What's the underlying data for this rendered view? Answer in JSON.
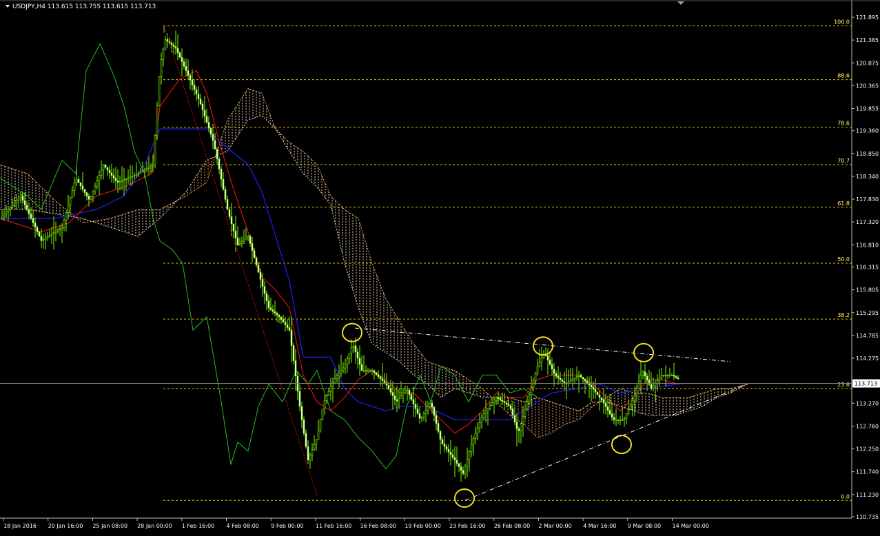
{
  "chart_data": {
    "type": "candlestick",
    "symbol_header": "USDJPY,H4  113.615 113.755 113.615 113.713",
    "y_ticks": [
      "121.895",
      "121.385",
      "120.875",
      "120.365",
      "119.855",
      "119.360",
      "118.850",
      "118.340",
      "117.830",
      "117.320",
      "116.810",
      "116.315",
      "115.805",
      "115.295",
      "114.785",
      "114.275",
      "113.713",
      "113.270",
      "112.760",
      "112.250",
      "111.740",
      "111.230",
      "110.735"
    ],
    "ylim": [
      110.735,
      121.895
    ],
    "x_ticks": [
      "18 Jan 2016",
      "20 Jan 16:00",
      "25 Jan 08:00",
      "28 Jan 00:00",
      "1 Feb 16:00",
      "4 Feb 08:00",
      "9 Feb 00:00",
      "11 Feb 16:00",
      "16 Feb 08:00",
      "19 Feb 00:00",
      "23 Feb 16:00",
      "26 Feb 08:00",
      "2 Mar 00:00",
      "4 Mar 16:00",
      "9 Mar 08:00",
      "14 Mar 00:00"
    ],
    "current_price": "113.713",
    "fibonacci": {
      "high": 121.7,
      "low": 111.1,
      "levels": [
        {
          "label": "100.0",
          "value": 121.7
        },
        {
          "label": "88.6",
          "value": 120.5
        },
        {
          "label": "78.6",
          "value": 119.44
        },
        {
          "label": "70.7",
          "value": 118.6
        },
        {
          "label": "61.8",
          "value": 117.65
        },
        {
          "label": "50.0",
          "value": 116.4
        },
        {
          "label": "38.2",
          "value": 115.15
        },
        {
          "label": "23.6",
          "value": 113.6
        },
        {
          "label": "0.0",
          "value": 111.1
        }
      ]
    },
    "price_path": [
      [
        0,
        117.4
      ],
      [
        30,
        117.9
      ],
      [
        60,
        116.9
      ],
      [
        90,
        117.2
      ],
      [
        110,
        118.3
      ],
      [
        130,
        117.8
      ],
      [
        150,
        118.6
      ],
      [
        170,
        118.2
      ],
      [
        200,
        118.4
      ],
      [
        222,
        118.6
      ],
      [
        232,
        120.8
      ],
      [
        240,
        121.4
      ],
      [
        255,
        121.2
      ],
      [
        270,
        120.7
      ],
      [
        290,
        120.0
      ],
      [
        310,
        119.1
      ],
      [
        330,
        117.6
      ],
      [
        345,
        116.8
      ],
      [
        360,
        117.0
      ],
      [
        375,
        116.2
      ],
      [
        390,
        115.4
      ],
      [
        405,
        115.2
      ],
      [
        420,
        114.9
      ],
      [
        435,
        113.2
      ],
      [
        447,
        112.0
      ],
      [
        460,
        112.5
      ],
      [
        470,
        113.3
      ],
      [
        485,
        113.8
      ],
      [
        500,
        114.1
      ],
      [
        512,
        114.6
      ],
      [
        525,
        114.0
      ],
      [
        540,
        114.0
      ],
      [
        560,
        113.7
      ],
      [
        575,
        113.3
      ],
      [
        590,
        113.6
      ],
      [
        610,
        112.9
      ],
      [
        625,
        113.3
      ],
      [
        640,
        112.4
      ],
      [
        660,
        112.0
      ],
      [
        672,
        111.7
      ],
      [
        685,
        112.4
      ],
      [
        700,
        113.0
      ],
      [
        720,
        113.4
      ],
      [
        740,
        113.2
      ],
      [
        752,
        112.6
      ],
      [
        765,
        113.3
      ],
      [
        780,
        114.1
      ],
      [
        790,
        114.4
      ],
      [
        805,
        113.9
      ],
      [
        820,
        113.7
      ],
      [
        840,
        113.9
      ],
      [
        860,
        113.6
      ],
      [
        875,
        113.3
      ],
      [
        890,
        112.9
      ],
      [
        905,
        112.9
      ],
      [
        920,
        113.4
      ],
      [
        932,
        114.0
      ],
      [
        945,
        113.6
      ],
      [
        960,
        113.9
      ],
      [
        975,
        113.9
      ],
      [
        985,
        113.8
      ]
    ],
    "tenkan": [
      [
        0,
        117.4
      ],
      [
        60,
        117.1
      ],
      [
        100,
        117.3
      ],
      [
        140,
        117.9
      ],
      [
        180,
        118.1
      ],
      [
        220,
        118.4
      ],
      [
        232,
        119.9
      ],
      [
        260,
        120.5
      ],
      [
        285,
        120.7
      ],
      [
        300,
        120.2
      ],
      [
        320,
        119.0
      ],
      [
        340,
        118.0
      ],
      [
        360,
        117.1
      ],
      [
        380,
        116.1
      ],
      [
        400,
        115.8
      ],
      [
        420,
        115.4
      ],
      [
        440,
        113.9
      ],
      [
        460,
        113.3
      ],
      [
        480,
        113.1
      ],
      [
        500,
        113.4
      ],
      [
        520,
        113.8
      ],
      [
        540,
        114.0
      ],
      [
        560,
        113.8
      ],
      [
        580,
        113.5
      ],
      [
        600,
        113.5
      ],
      [
        620,
        113.2
      ],
      [
        640,
        112.9
      ],
      [
        660,
        112.6
      ],
      [
        680,
        112.8
      ],
      [
        700,
        113.1
      ],
      [
        720,
        113.5
      ],
      [
        740,
        113.4
      ],
      [
        760,
        113.4
      ],
      [
        780,
        113.8
      ],
      [
        800,
        113.9
      ],
      [
        820,
        113.9
      ],
      [
        840,
        113.9
      ],
      [
        860,
        113.7
      ],
      [
        880,
        113.4
      ],
      [
        900,
        113.1
      ],
      [
        920,
        113.4
      ],
      [
        940,
        113.8
      ],
      [
        960,
        113.8
      ],
      [
        985,
        113.7
      ]
    ],
    "kijun": [
      [
        0,
        117.4
      ],
      [
        80,
        117.4
      ],
      [
        140,
        117.6
      ],
      [
        180,
        117.9
      ],
      [
        210,
        118.6
      ],
      [
        232,
        119.4
      ],
      [
        260,
        119.4
      ],
      [
        300,
        119.4
      ],
      [
        320,
        119.1
      ],
      [
        360,
        118.6
      ],
      [
        380,
        118.0
      ],
      [
        400,
        117.0
      ],
      [
        420,
        116.0
      ],
      [
        440,
        114.3
      ],
      [
        480,
        114.3
      ],
      [
        500,
        113.6
      ],
      [
        520,
        113.3
      ],
      [
        560,
        113.1
      ],
      [
        580,
        113.2
      ],
      [
        620,
        113.2
      ],
      [
        660,
        112.9
      ],
      [
        700,
        112.9
      ],
      [
        740,
        112.9
      ],
      [
        770,
        113.2
      ],
      [
        800,
        113.5
      ],
      [
        840,
        113.6
      ],
      [
        870,
        113.7
      ],
      [
        900,
        113.5
      ],
      [
        940,
        113.6
      ],
      [
        985,
        113.7
      ]
    ],
    "chikou": [
      [
        0,
        118.3
      ],
      [
        40,
        117.9
      ],
      [
        60,
        117.6
      ],
      [
        90,
        118.7
      ],
      [
        110,
        118.4
      ],
      [
        125,
        120.7
      ],
      [
        145,
        121.3
      ],
      [
        165,
        120.6
      ],
      [
        180,
        119.9
      ],
      [
        195,
        118.9
      ],
      [
        210,
        118.4
      ],
      [
        222,
        117.4
      ],
      [
        232,
        116.9
      ],
      [
        250,
        116.7
      ],
      [
        265,
        116.4
      ],
      [
        280,
        114.9
      ],
      [
        300,
        115.2
      ],
      [
        320,
        113.4
      ],
      [
        335,
        111.9
      ],
      [
        345,
        112.4
      ],
      [
        360,
        112.2
      ],
      [
        375,
        113.2
      ],
      [
        390,
        113.7
      ],
      [
        410,
        113.3
      ],
      [
        430,
        114.0
      ],
      [
        447,
        113.7
      ],
      [
        460,
        114.0
      ],
      [
        480,
        113.1
      ],
      [
        500,
        112.9
      ],
      [
        520,
        112.5
      ],
      [
        540,
        112.2
      ],
      [
        560,
        111.8
      ],
      [
        575,
        112.1
      ],
      [
        590,
        113.2
      ],
      [
        610,
        113.9
      ],
      [
        625,
        113.3
      ],
      [
        640,
        114.1
      ],
      [
        660,
        113.9
      ],
      [
        680,
        113.3
      ],
      [
        700,
        113.9
      ],
      [
        720,
        113.9
      ],
      [
        740,
        113.5
      ],
      [
        760,
        113.6
      ],
      [
        780,
        113.4
      ]
    ],
    "cloud": {
      "span_a": [
        [
          0,
          118.6
        ],
        [
          40,
          118.4
        ],
        [
          80,
          117.8
        ],
        [
          120,
          117.3
        ],
        [
          160,
          117.4
        ],
        [
          200,
          117.6
        ],
        [
          232,
          117.6
        ],
        [
          270,
          117.9
        ],
        [
          300,
          118.2
        ],
        [
          330,
          119.6
        ],
        [
          360,
          120.3
        ],
        [
          380,
          120.2
        ],
        [
          400,
          119.4
        ],
        [
          420,
          119.1
        ],
        [
          440,
          118.9
        ],
        [
          460,
          118.6
        ],
        [
          480,
          117.9
        ],
        [
          500,
          117.6
        ],
        [
          520,
          117.4
        ],
        [
          540,
          116.4
        ],
        [
          560,
          115.6
        ],
        [
          580,
          115.1
        ],
        [
          600,
          114.6
        ],
        [
          620,
          114.2
        ],
        [
          640,
          114.1
        ],
        [
          660,
          114.0
        ],
        [
          680,
          113.8
        ],
        [
          700,
          113.6
        ],
        [
          720,
          113.3
        ],
        [
          740,
          113.0
        ],
        [
          760,
          112.8
        ],
        [
          780,
          112.5
        ],
        [
          800,
          112.6
        ],
        [
          820,
          112.8
        ],
        [
          840,
          112.9
        ],
        [
          860,
          113.2
        ],
        [
          880,
          113.4
        ],
        [
          900,
          113.6
        ],
        [
          920,
          113.5
        ],
        [
          940,
          113.5
        ],
        [
          960,
          113.4
        ],
        [
          980,
          113.4
        ],
        [
          1000,
          113.4
        ],
        [
          1020,
          113.5
        ],
        [
          1040,
          113.6
        ],
        [
          1060,
          113.6
        ],
        [
          1085,
          113.7
        ]
      ],
      "span_b": [
        [
          0,
          117.6
        ],
        [
          40,
          117.6
        ],
        [
          80,
          117.5
        ],
        [
          120,
          117.4
        ],
        [
          160,
          117.2
        ],
        [
          200,
          117.0
        ],
        [
          232,
          117.4
        ],
        [
          270,
          118.0
        ],
        [
          300,
          118.7
        ],
        [
          330,
          118.9
        ],
        [
          360,
          119.6
        ],
        [
          380,
          119.7
        ],
        [
          400,
          119.4
        ],
        [
          420,
          118.9
        ],
        [
          440,
          118.4
        ],
        [
          460,
          118.1
        ],
        [
          480,
          117.7
        ],
        [
          500,
          116.4
        ],
        [
          520,
          115.4
        ],
        [
          540,
          114.6
        ],
        [
          560,
          114.4
        ],
        [
          580,
          114.2
        ],
        [
          600,
          113.9
        ],
        [
          620,
          113.7
        ],
        [
          640,
          113.4
        ],
        [
          660,
          113.6
        ],
        [
          680,
          113.5
        ],
        [
          700,
          113.4
        ],
        [
          720,
          113.4
        ],
        [
          740,
          113.4
        ],
        [
          760,
          113.3
        ],
        [
          780,
          113.4
        ],
        [
          800,
          113.3
        ],
        [
          820,
          113.2
        ],
        [
          840,
          113.1
        ],
        [
          860,
          113.3
        ],
        [
          880,
          113.3
        ],
        [
          900,
          113.2
        ],
        [
          920,
          113.1
        ],
        [
          940,
          113.0
        ],
        [
          960,
          113.0
        ],
        [
          980,
          113.0
        ],
        [
          1000,
          113.1
        ],
        [
          1020,
          113.2
        ],
        [
          1040,
          113.4
        ],
        [
          1060,
          113.5
        ],
        [
          1085,
          113.7
        ]
      ]
    },
    "trendlines": {
      "upper": [
        [
          515,
          114.95
        ],
        [
          1060,
          114.2
        ]
      ],
      "lower": [
        [
          675,
          111.1
        ],
        [
          1085,
          113.7
        ]
      ],
      "red_diagonal": [
        [
          240,
          121.6
        ],
        [
          460,
          111.2
        ]
      ]
    },
    "circled_points": [
      [
        511,
        114.85
      ],
      [
        788,
        114.55
      ],
      [
        934,
        114.4
      ],
      [
        674,
        111.15
      ],
      [
        902,
        112.35
      ]
    ]
  }
}
